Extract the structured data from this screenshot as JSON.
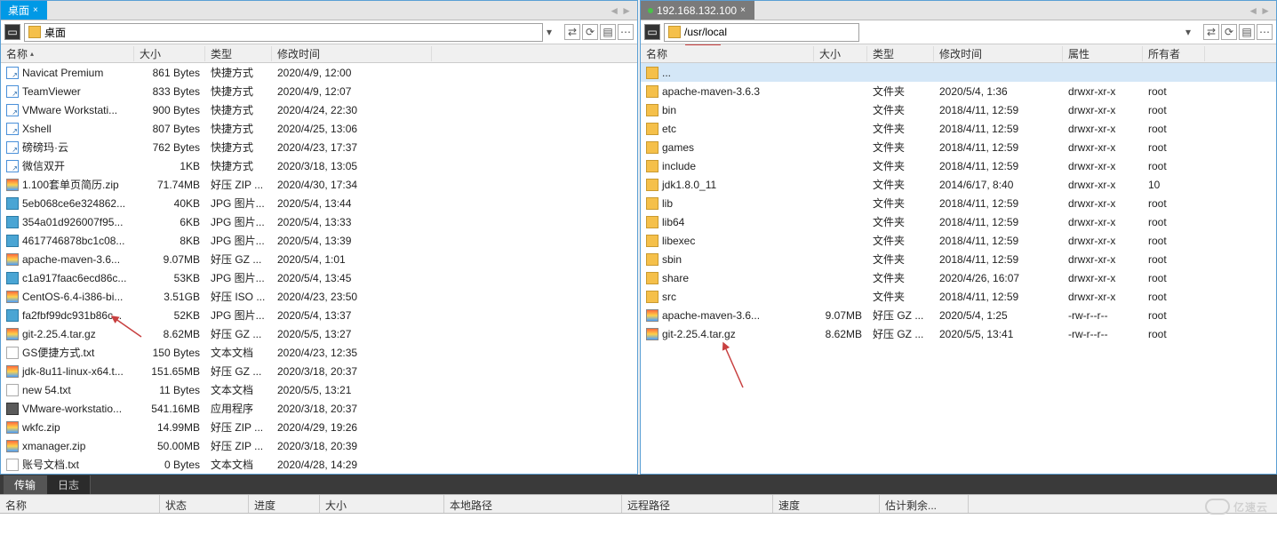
{
  "left": {
    "tab": "桌面",
    "path_label": "桌面",
    "headers": {
      "name": "名称",
      "size": "大小",
      "type": "类型",
      "date": "修改时间"
    },
    "rows": [
      {
        "ic": "link",
        "name": "Navicat Premium",
        "size": "861 Bytes",
        "type": "快捷方式",
        "date": "2020/4/9, 12:00"
      },
      {
        "ic": "link",
        "name": "TeamViewer",
        "size": "833 Bytes",
        "type": "快捷方式",
        "date": "2020/4/9, 12:07"
      },
      {
        "ic": "link",
        "name": "VMware Workstati...",
        "size": "900 Bytes",
        "type": "快捷方式",
        "date": "2020/4/24, 22:30"
      },
      {
        "ic": "link",
        "name": "Xshell",
        "size": "807 Bytes",
        "type": "快捷方式",
        "date": "2020/4/25, 13:06"
      },
      {
        "ic": "link",
        "name": "磅磅玛·云",
        "size": "762 Bytes",
        "type": "快捷方式",
        "date": "2020/4/23, 17:37"
      },
      {
        "ic": "link",
        "name": "微信双开",
        "size": "1KB",
        "type": "快捷方式",
        "date": "2020/3/18, 13:05"
      },
      {
        "ic": "gz",
        "name": "1.100套单页简历.zip",
        "size": "71.74MB",
        "type": "好压 ZIP ...",
        "date": "2020/4/30, 17:34"
      },
      {
        "ic": "jpg",
        "name": "5eb068ce6e324862...",
        "size": "40KB",
        "type": "JPG 图片...",
        "date": "2020/5/4, 13:44"
      },
      {
        "ic": "jpg",
        "name": "354a01d926007f95...",
        "size": "6KB",
        "type": "JPG 图片...",
        "date": "2020/5/4, 13:33"
      },
      {
        "ic": "jpg",
        "name": "4617746878bc1c08...",
        "size": "8KB",
        "type": "JPG 图片...",
        "date": "2020/5/4, 13:39"
      },
      {
        "ic": "gz",
        "name": "apache-maven-3.6...",
        "size": "9.07MB",
        "type": "好压 GZ ...",
        "date": "2020/5/4, 1:01"
      },
      {
        "ic": "jpg",
        "name": "c1a917faac6ecd86c...",
        "size": "53KB",
        "type": "JPG 图片...",
        "date": "2020/5/4, 13:45"
      },
      {
        "ic": "gz",
        "name": "CentOS-6.4-i386-bi...",
        "size": "3.51GB",
        "type": "好压 ISO ...",
        "date": "2020/4/23, 23:50"
      },
      {
        "ic": "jpg",
        "name": "fa2fbf99dc931b86c...",
        "size": "52KB",
        "type": "JPG 图片...",
        "date": "2020/5/4, 13:37"
      },
      {
        "ic": "gz",
        "name": "git-2.25.4.tar.gz",
        "size": "8.62MB",
        "type": "好压 GZ ...",
        "date": "2020/5/5, 13:27",
        "hl": true
      },
      {
        "ic": "txt",
        "name": "GS便捷方式.txt",
        "size": "150 Bytes",
        "type": "文本文档",
        "date": "2020/4/23, 12:35"
      },
      {
        "ic": "gz",
        "name": "jdk-8u11-linux-x64.t...",
        "size": "151.65MB",
        "type": "好压 GZ ...",
        "date": "2020/3/18, 20:37"
      },
      {
        "ic": "txt",
        "name": "new 54.txt",
        "size": "11 Bytes",
        "type": "文本文档",
        "date": "2020/5/5, 13:21"
      },
      {
        "ic": "exe",
        "name": "VMware-workstatio...",
        "size": "541.16MB",
        "type": "应用程序",
        "date": "2020/3/18, 20:37"
      },
      {
        "ic": "gz",
        "name": "wkfc.zip",
        "size": "14.99MB",
        "type": "好压 ZIP ...",
        "date": "2020/4/29, 19:26"
      },
      {
        "ic": "gz",
        "name": "xmanager.zip",
        "size": "50.00MB",
        "type": "好压 ZIP ...",
        "date": "2020/3/18, 20:39"
      },
      {
        "ic": "txt",
        "name": "账号文档.txt",
        "size": "0 Bytes",
        "type": "文本文档",
        "date": "2020/4/28, 14:29"
      }
    ]
  },
  "right": {
    "tab": "192.168.132.100",
    "path_label": "/usr/local",
    "headers": {
      "name": "名称",
      "size": "大小",
      "type": "类型",
      "date": "修改时间",
      "attr": "属性",
      "own": "所有者"
    },
    "rows": [
      {
        "ic": "folder",
        "name": "...",
        "sel": true
      },
      {
        "ic": "folder",
        "name": "apache-maven-3.6.3",
        "type": "文件夹",
        "date": "2020/5/4, 1:36",
        "attr": "drwxr-xr-x",
        "own": "root"
      },
      {
        "ic": "folder",
        "name": "bin",
        "type": "文件夹",
        "date": "2018/4/11, 12:59",
        "attr": "drwxr-xr-x",
        "own": "root"
      },
      {
        "ic": "folder",
        "name": "etc",
        "type": "文件夹",
        "date": "2018/4/11, 12:59",
        "attr": "drwxr-xr-x",
        "own": "root"
      },
      {
        "ic": "folder",
        "name": "games",
        "type": "文件夹",
        "date": "2018/4/11, 12:59",
        "attr": "drwxr-xr-x",
        "own": "root"
      },
      {
        "ic": "folder",
        "name": "include",
        "type": "文件夹",
        "date": "2018/4/11, 12:59",
        "attr": "drwxr-xr-x",
        "own": "root"
      },
      {
        "ic": "folder",
        "name": "jdk1.8.0_11",
        "type": "文件夹",
        "date": "2014/6/17, 8:40",
        "attr": "drwxr-xr-x",
        "own": "10"
      },
      {
        "ic": "folder",
        "name": "lib",
        "type": "文件夹",
        "date": "2018/4/11, 12:59",
        "attr": "drwxr-xr-x",
        "own": "root"
      },
      {
        "ic": "folder",
        "name": "lib64",
        "type": "文件夹",
        "date": "2018/4/11, 12:59",
        "attr": "drwxr-xr-x",
        "own": "root"
      },
      {
        "ic": "folder",
        "name": "libexec",
        "type": "文件夹",
        "date": "2018/4/11, 12:59",
        "attr": "drwxr-xr-x",
        "own": "root"
      },
      {
        "ic": "folder",
        "name": "sbin",
        "type": "文件夹",
        "date": "2018/4/11, 12:59",
        "attr": "drwxr-xr-x",
        "own": "root"
      },
      {
        "ic": "folder",
        "name": "share",
        "type": "文件夹",
        "date": "2020/4/26, 16:07",
        "attr": "drwxr-xr-x",
        "own": "root"
      },
      {
        "ic": "folder",
        "name": "src",
        "type": "文件夹",
        "date": "2018/4/11, 12:59",
        "attr": "drwxr-xr-x",
        "own": "root"
      },
      {
        "ic": "gz",
        "name": "apache-maven-3.6...",
        "size": "9.07MB",
        "type": "好压 GZ ...",
        "date": "2020/5/4, 1:25",
        "attr": "-rw-r--r--",
        "own": "root"
      },
      {
        "ic": "gz",
        "name": "git-2.25.4.tar.gz",
        "size": "8.62MB",
        "type": "好压 GZ ...",
        "date": "2020/5/5, 13:41",
        "attr": "-rw-r--r--",
        "own": "root"
      }
    ]
  },
  "bottom": {
    "tabs": {
      "transfer": "传输",
      "log": "日志"
    },
    "cols": {
      "name": "名称",
      "status": "状态",
      "progress": "进度",
      "size": "大小",
      "local": "本地路径",
      "remote": "远程路径",
      "speed": "速度",
      "eta": "估计剩余..."
    }
  },
  "watermark": "亿速云"
}
